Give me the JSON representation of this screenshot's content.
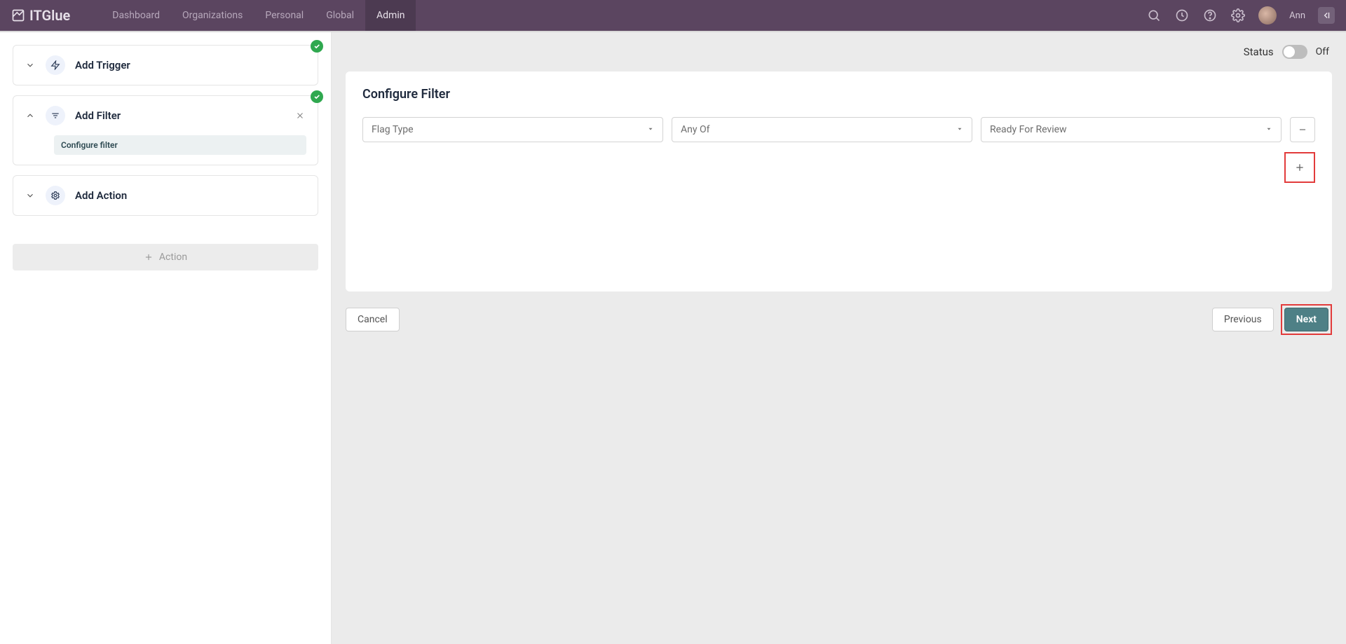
{
  "brand": "ITGlue",
  "nav": {
    "dashboard": "Dashboard",
    "organizations": "Organizations",
    "personal": "Personal",
    "global": "Global",
    "admin": "Admin"
  },
  "user": {
    "name": "Ann"
  },
  "status": {
    "label": "Status",
    "value": "Off"
  },
  "steps": {
    "trigger": {
      "title": "Add Trigger"
    },
    "filter": {
      "title": "Add Filter",
      "sub": "Configure filter"
    },
    "action": {
      "title": "Add Action"
    }
  },
  "actionBar": {
    "label": "Action"
  },
  "panel": {
    "title": "Configure Filter",
    "selects": {
      "flagType": "Flag Type",
      "operator": "Any Of",
      "value": "Ready For Review"
    }
  },
  "footer": {
    "cancel": "Cancel",
    "previous": "Previous",
    "next": "Next"
  }
}
